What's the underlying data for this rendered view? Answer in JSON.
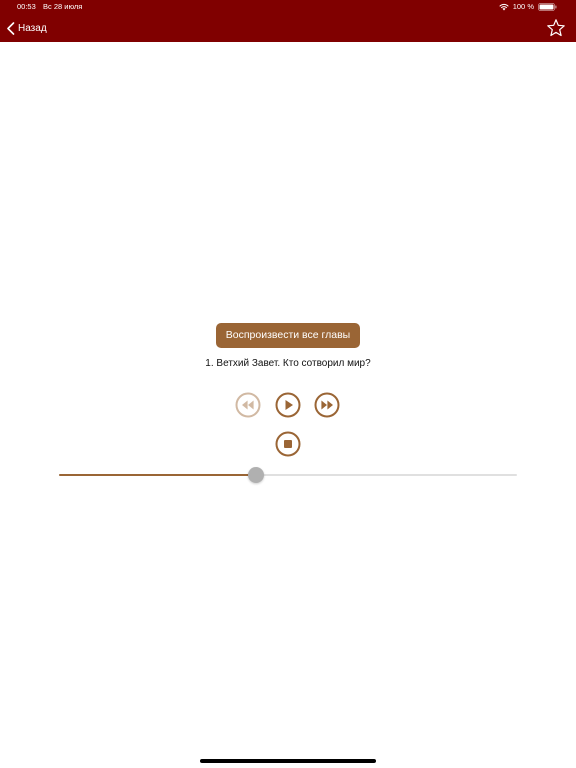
{
  "status_bar": {
    "time": "00:53",
    "date": "Вс 28 июля",
    "battery": "100 %",
    "icons": [
      "wifi-icon",
      "battery-icon"
    ]
  },
  "nav_bar": {
    "back_label": "Назад",
    "back_icon": "chevron-left-icon",
    "favorite_icon": "star-outline-icon",
    "background_color": "#800000"
  },
  "player": {
    "play_all_label": "Воспроизвести все главы",
    "track_title": "1. Ветхий Завет. Кто сотворил мир?",
    "controls": {
      "rewind_icon": "rewind-icon",
      "rewind_enabled": false,
      "play_icon": "play-icon",
      "forward_icon": "fast-forward-icon",
      "stop_icon": "stop-icon"
    },
    "progress": 0.43,
    "accent_color": "#9a6535"
  }
}
